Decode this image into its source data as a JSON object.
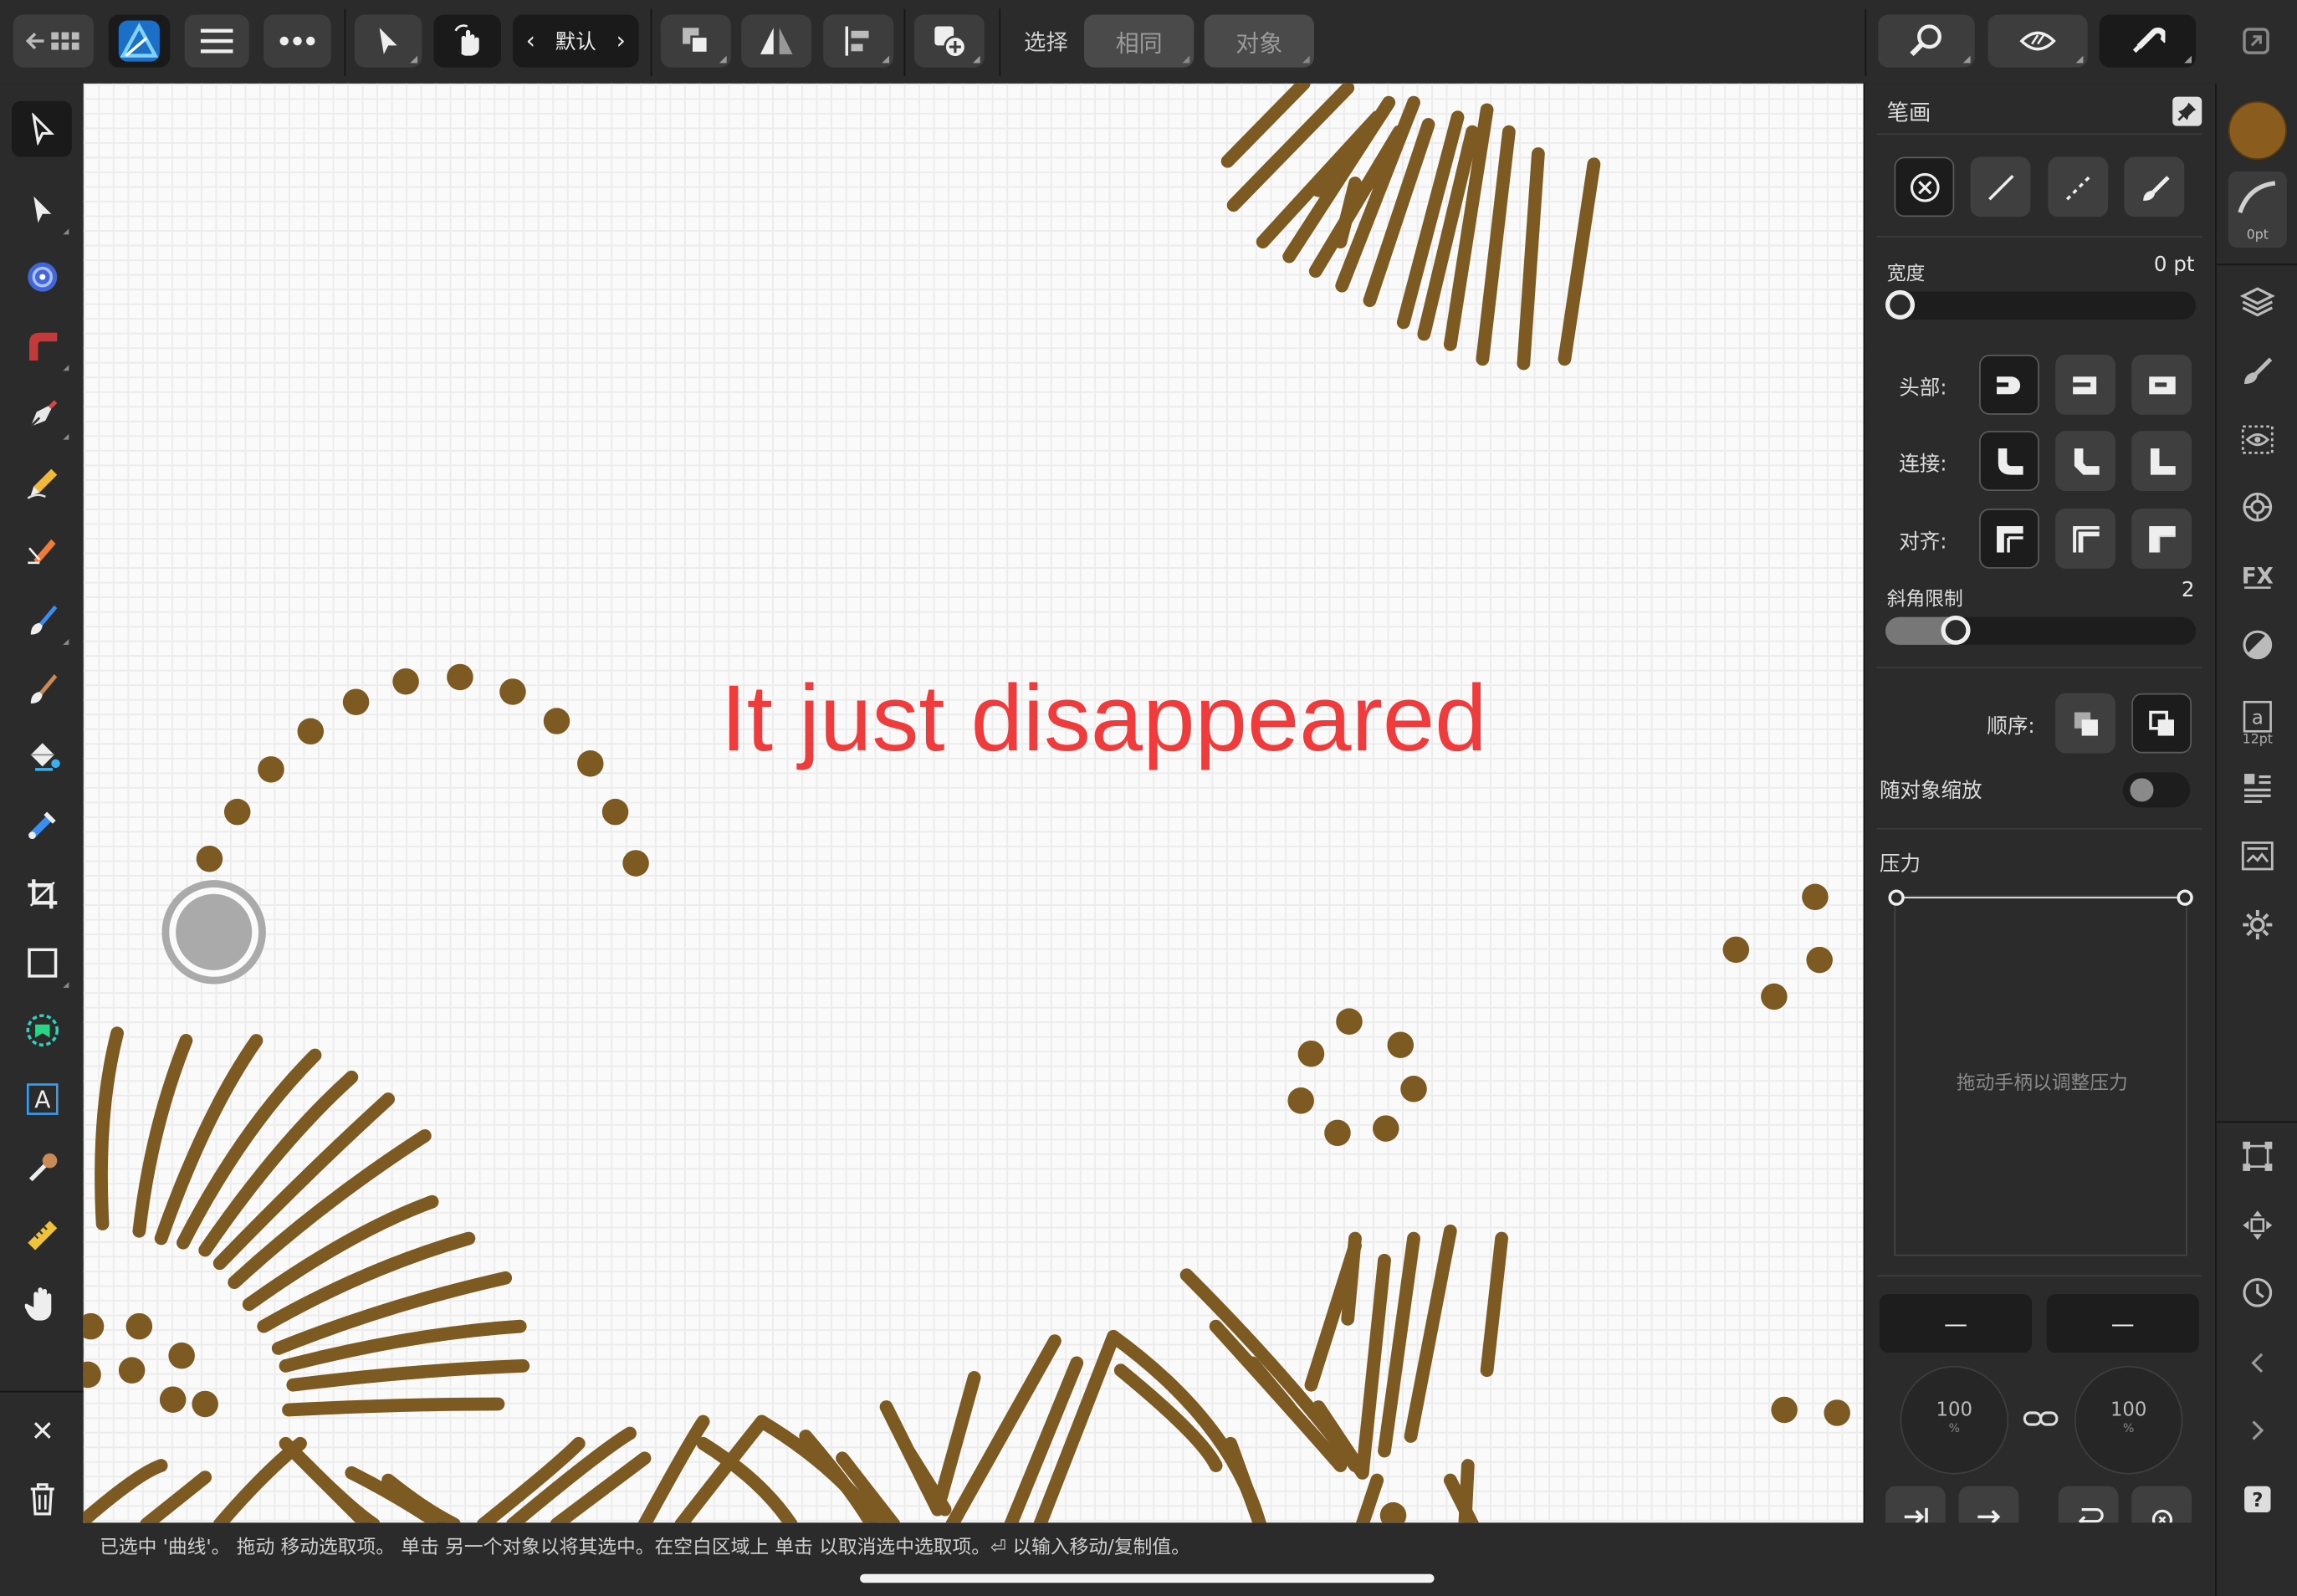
{
  "toolbar": {
    "preset_label": "默认",
    "select_label": "选择",
    "same_button": "相同",
    "object_button": "对象"
  },
  "canvas": {
    "annotation": "It just disappeared",
    "stroke_color": "#7d5a22"
  },
  "status_bar": {
    "text": "已选中 '曲线'。 拖动 移动选取项。 单击 另一个对象以将其选中。在空白区域上 单击 以取消选中选取项。⏎ 以输入移动/复制值。"
  },
  "stroke_panel": {
    "title": "笔画",
    "width_label": "宽度",
    "width_value": "0 pt",
    "cap_label": "头部:",
    "join_label": "连接:",
    "align_label": "对齐:",
    "miter_label": "斜角限制",
    "miter_value": "2",
    "order_label": "顺序:",
    "scale_label": "随对象缩放",
    "pressure_label": "压力",
    "pressure_hint": "拖动手柄以调整压力",
    "start_arrow": "—",
    "end_arrow": "—",
    "start_scale": "100",
    "start_scale_unit": "%",
    "end_scale": "100",
    "end_scale_unit": "%"
  },
  "right_bar": {
    "stroke_size_label": "0pt",
    "text_size_label": "12pt",
    "fill_color": "#8a5d1f"
  }
}
